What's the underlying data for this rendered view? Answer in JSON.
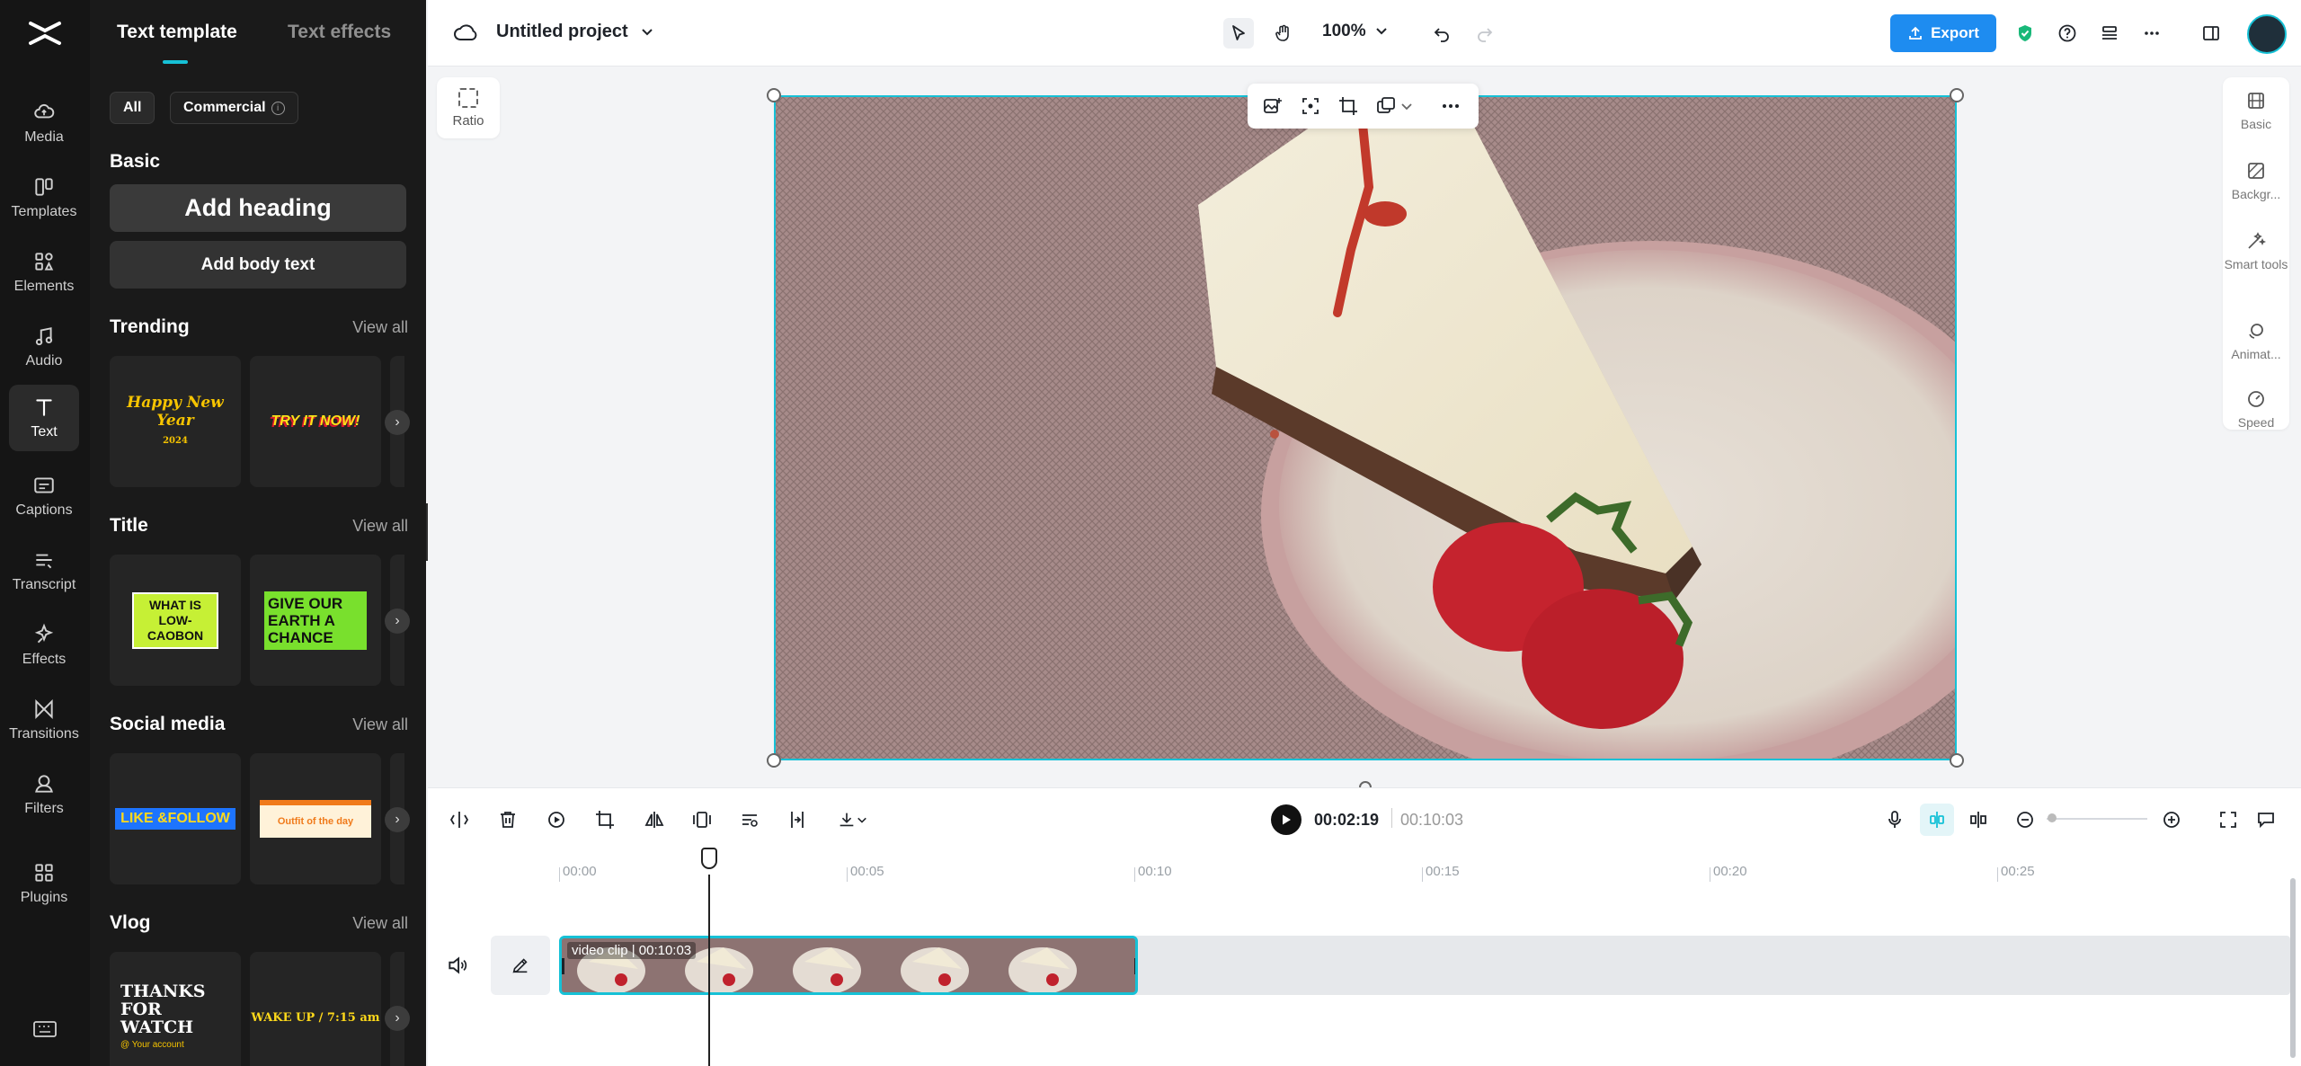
{
  "nav": {
    "items": [
      {
        "label": "Media",
        "icon": "media-icon"
      },
      {
        "label": "Templates",
        "icon": "templates-icon"
      },
      {
        "label": "Elements",
        "icon": "elements-icon"
      },
      {
        "label": "Audio",
        "icon": "audio-icon"
      },
      {
        "label": "Text",
        "icon": "text-icon",
        "active": true
      },
      {
        "label": "Captions",
        "icon": "captions-icon"
      },
      {
        "label": "Transcript",
        "icon": "transcript-icon"
      },
      {
        "label": "Effects",
        "icon": "effects-icon"
      },
      {
        "label": "Transitions",
        "icon": "transitions-icon"
      },
      {
        "label": "Filters",
        "icon": "filters-icon"
      },
      {
        "label": "Plugins",
        "icon": "plugins-icon"
      }
    ]
  },
  "panel": {
    "tabs": [
      "Text template",
      "Text effects"
    ],
    "filters": {
      "all": "All",
      "commercial": "Commercial",
      "info": "i"
    },
    "basic": {
      "title": "Basic",
      "add_heading": "Add heading",
      "add_body": "Add body text"
    },
    "sections": [
      {
        "title": "Trending",
        "view_all": "View all",
        "cards": [
          "Happy New Year",
          "TRY IT NOW!"
        ],
        "card_sub": "2024"
      },
      {
        "title": "Title",
        "view_all": "View all",
        "cards": [
          "WHAT IS LOW-CAOBON",
          "GIVE OUR EARTH A CHANCE"
        ]
      },
      {
        "title": "Social media",
        "view_all": "View all",
        "cards": [
          "LIKE &FOLLOW",
          "Outfit of the day"
        ]
      },
      {
        "title": "Vlog",
        "view_all": "View all",
        "cards": [
          "THANKS FOR WATCH",
          "WAKE UP / 7:15 am"
        ],
        "card_sub": "@ Your account"
      }
    ]
  },
  "topbar": {
    "project_name": "Untitled project",
    "zoom": "100%",
    "export_label": "Export"
  },
  "stage": {
    "ratio_label": "Ratio",
    "right_tools": [
      "Basic",
      "Backgr...",
      "Smart tools",
      "Animat...",
      "Speed"
    ]
  },
  "timeline": {
    "current_time": "00:02:19",
    "total_time": "00:10:03",
    "ruler": [
      "00:00",
      "00:05",
      "00:10",
      "00:15",
      "00:20",
      "00:25"
    ],
    "clip_label": "video clip | 00:10:03"
  },
  "colors": {
    "accent": "#16c1d6",
    "export": "#1e8cf0",
    "shield": "#19b879"
  }
}
